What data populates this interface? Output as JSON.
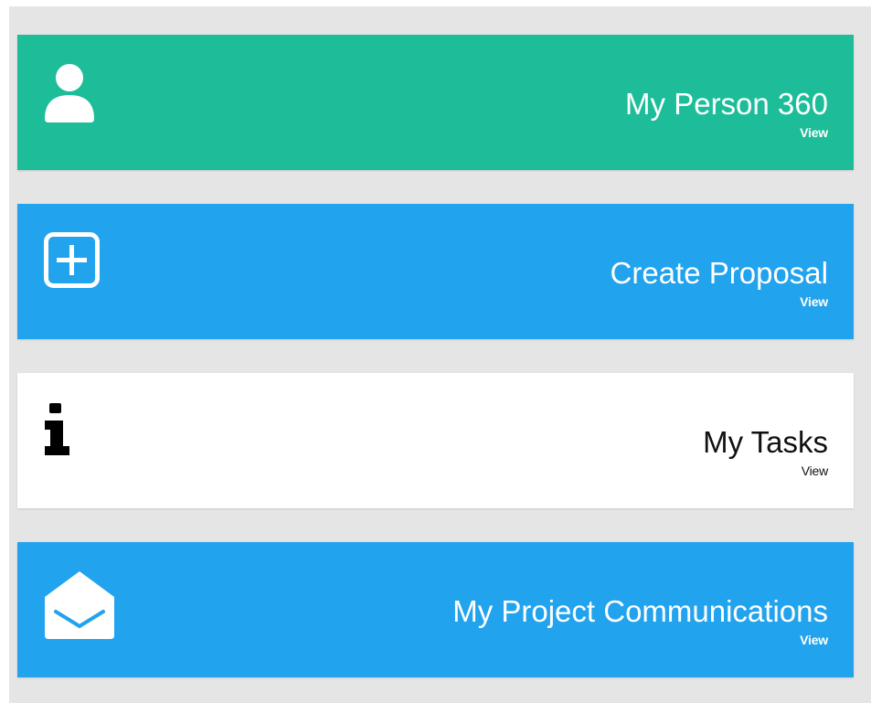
{
  "tiles": [
    {
      "title": "My Person 360",
      "link_label": "View",
      "icon": "user-icon",
      "color": "#1dbd99"
    },
    {
      "title": "Create Proposal",
      "link_label": "View",
      "icon": "plus-square-icon",
      "color": "#22a3ee"
    },
    {
      "title": "My Tasks",
      "link_label": "View",
      "icon": "info-icon",
      "color": "#ffffff"
    },
    {
      "title": "My Project Communications",
      "link_label": "View",
      "icon": "envelope-open-icon",
      "color": "#22a3ee"
    }
  ]
}
